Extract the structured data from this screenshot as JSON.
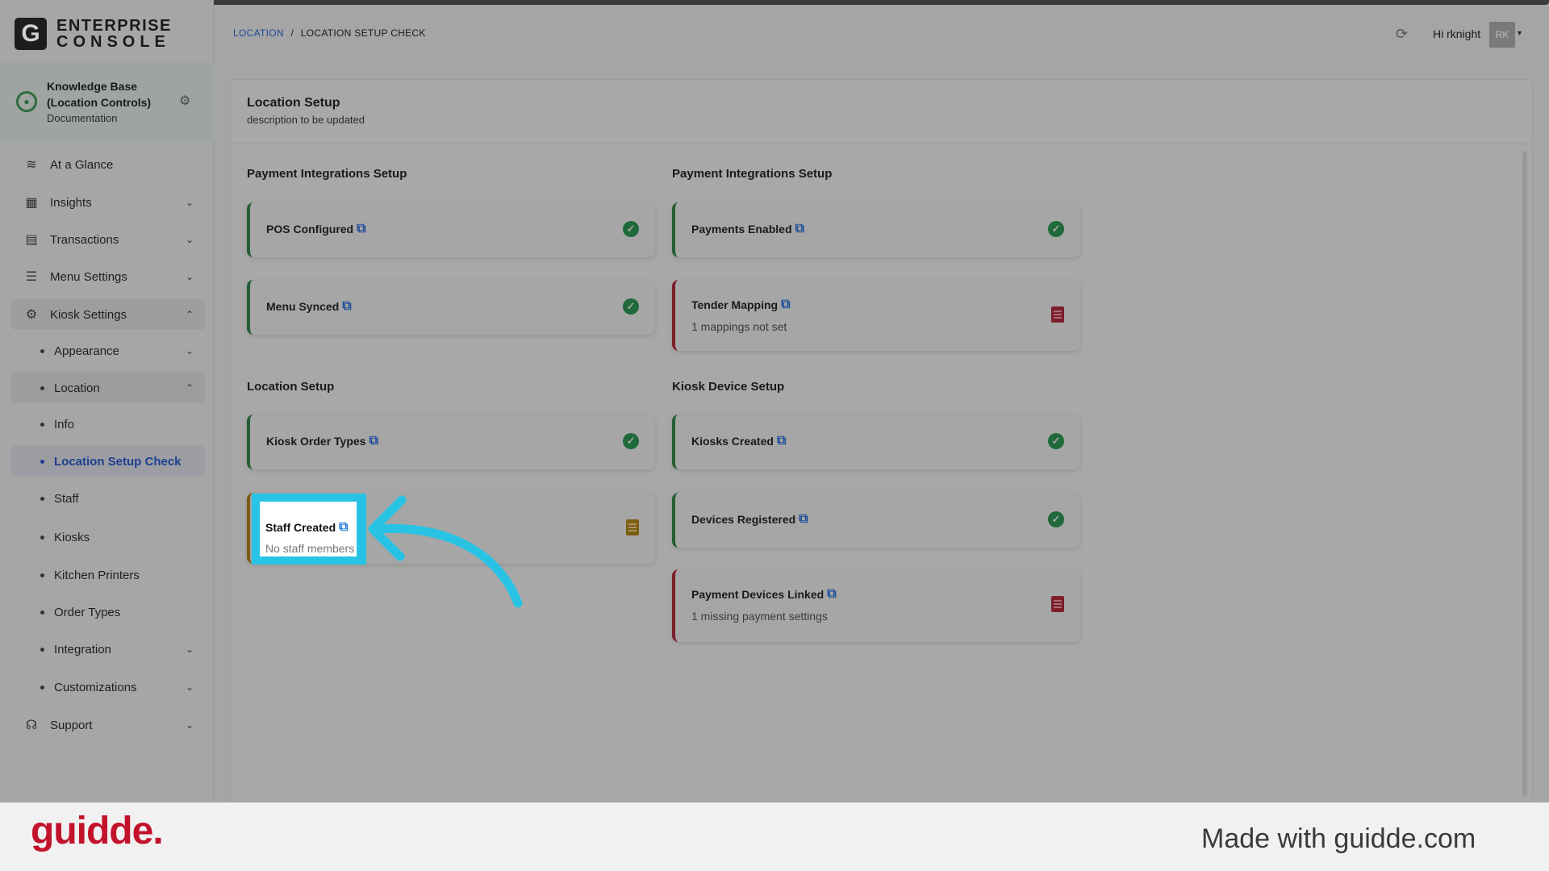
{
  "app": {
    "logo_letter": "G",
    "logo_line1": "ENTERPRISE",
    "logo_line2": "CONSOLE"
  },
  "org": {
    "name": "Knowledge Base (Location Controls)",
    "subtitle": "Documentation"
  },
  "sidebar": {
    "items": [
      {
        "label": "At a Glance",
        "icon": "layers-icon"
      },
      {
        "label": "Insights",
        "icon": "report-icon"
      },
      {
        "label": "Transactions",
        "icon": "receipt-icon"
      },
      {
        "label": "Menu Settings",
        "icon": "menu-icon"
      },
      {
        "label": "Kiosk Settings",
        "icon": "gear-icon"
      },
      {
        "label": "Appearance"
      },
      {
        "label": "Location"
      },
      {
        "label": "Info"
      },
      {
        "label": "Location Setup Check"
      },
      {
        "label": "Staff"
      },
      {
        "label": "Kiosks"
      },
      {
        "label": "Kitchen Printers"
      },
      {
        "label": "Order Types"
      },
      {
        "label": "Integration"
      },
      {
        "label": "Customizations"
      },
      {
        "label": "Support",
        "icon": "headset-icon"
      }
    ]
  },
  "header": {
    "breadcrumb_link": "LOCATION",
    "breadcrumb_sep": "/",
    "breadcrumb_current": "LOCATION SETUP CHECK",
    "greeting": "Hi rknight",
    "avatar_initials": "RK"
  },
  "panel": {
    "title": "Location Setup",
    "description": "description to be updated"
  },
  "sections": {
    "left_top": "Payment Integrations Setup",
    "right_top": "Payment Integrations Setup",
    "left_bottom": "Location Setup",
    "right_bottom": "Kiosk Device Setup"
  },
  "cards": {
    "pos": {
      "label": "POS Configured",
      "status": "ok"
    },
    "menu": {
      "label": "Menu Synced",
      "status": "ok"
    },
    "order_types": {
      "label": "Kiosk Order Types",
      "status": "ok"
    },
    "staff": {
      "label": "Staff Created",
      "sub": "No staff members",
      "status": "warning"
    },
    "payments": {
      "label": "Payments Enabled",
      "status": "ok"
    },
    "tender": {
      "label": "Tender Mapping",
      "sub": "1 mappings not set",
      "status": "error"
    },
    "kiosks": {
      "label": "Kiosks Created",
      "status": "ok"
    },
    "devices": {
      "label": "Devices Registered",
      "status": "ok"
    },
    "payment_devices": {
      "label": "Payment Devices Linked",
      "sub": "1 missing payment settings",
      "status": "error"
    }
  },
  "colors": {
    "ok": "#1f6a3a",
    "error": "#7c1e2b",
    "warning": "#7d5e12",
    "highlight": "#28c3e4",
    "brand": "#c3122b"
  },
  "footer": {
    "brand": "guidde.",
    "made_with": "Made with guidde.com"
  }
}
